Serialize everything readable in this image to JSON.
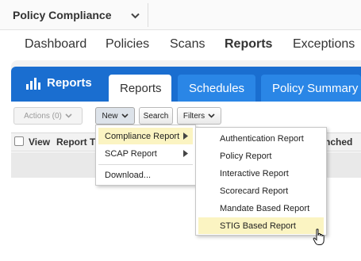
{
  "app": {
    "title": "Policy Compliance"
  },
  "nav": {
    "items": [
      "Dashboard",
      "Policies",
      "Scans",
      "Reports",
      "Exceptions"
    ],
    "active": "Reports"
  },
  "module": {
    "title": "Reports",
    "tabs": [
      "Reports",
      "Schedules",
      "Policy Summary"
    ],
    "active_tab": "Reports"
  },
  "toolbar": {
    "actions": "Actions (0)",
    "new": "New",
    "search": "Search",
    "filters": "Filters"
  },
  "table": {
    "headers": [
      "View",
      "Report T",
      "nched"
    ]
  },
  "new_menu": {
    "items": [
      "Compliance Report",
      "SCAP Report",
      "Download..."
    ],
    "highlighted": "Compliance Report"
  },
  "compliance_submenu": {
    "items": [
      "Authentication Report",
      "Policy Report",
      "Interactive Report",
      "Scorecard Report",
      "Mandate Based Report",
      "STIG Based Report"
    ],
    "highlighted": "STIG Based Report"
  },
  "colors": {
    "accent": "#1a6ed0",
    "tab": "#2a86e6",
    "highlight": "#fbf4c2"
  }
}
